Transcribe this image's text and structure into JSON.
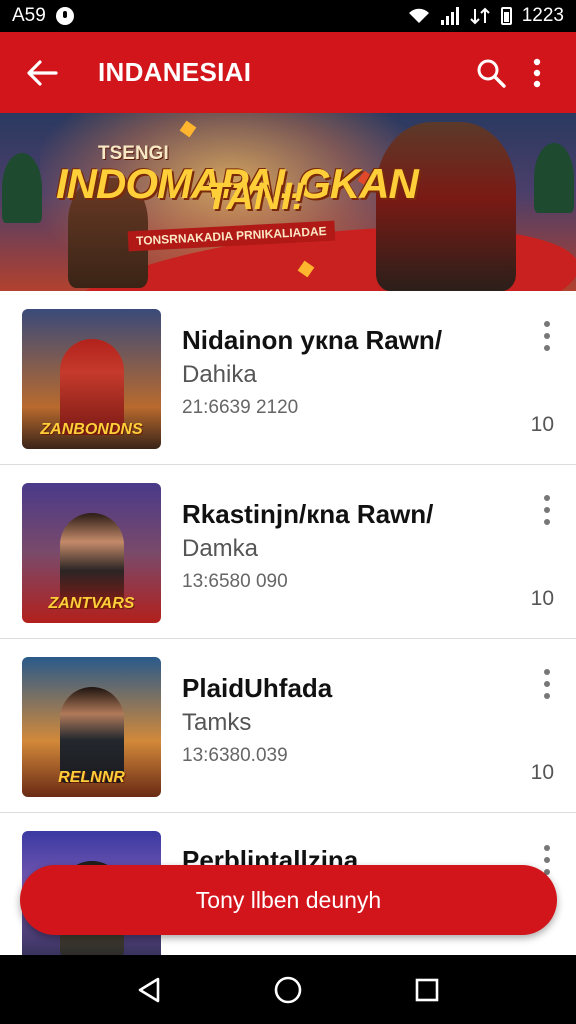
{
  "status_bar": {
    "left_text": "A59",
    "time": "1223",
    "icons": [
      "notification-dot-icon",
      "wifi-icon",
      "signal-icon",
      "data-icon",
      "battery-icon"
    ]
  },
  "app_bar": {
    "title": "INDANESIAI",
    "back_icon": "arrow-back-icon",
    "search_icon": "search-icon",
    "more_icon": "more-vertical-icon",
    "background": "#d2141b"
  },
  "banner": {
    "small_title": "TSENGI",
    "title_line1": "INDOMAPALGKAN",
    "title_line2": "TANI!",
    "subtitle": "TONSRNAKADIA PRNIKALIADAE"
  },
  "list": {
    "items": [
      {
        "title": "Nidainon yкna Rawn/",
        "subtitle": "Dahika",
        "meta": "21:6639 2120",
        "count": "10",
        "thumb_label": "ZANBONDNS"
      },
      {
        "title": "Rkastinjn/кna Rawn/",
        "subtitle": "Damka",
        "meta": "13:6580 090",
        "count": "10",
        "thumb_label": "ZANTVARS"
      },
      {
        "title": "PlaidUhfada",
        "subtitle": "Tamks",
        "meta": "13:6380.039",
        "count": "10",
        "thumb_label": "RELNNR"
      },
      {
        "title": "Perblintallzina",
        "subtitle": "",
        "meta": "",
        "count": "",
        "thumb_label": ""
      }
    ]
  },
  "fab": {
    "label": "Tony llben deunyh"
  },
  "nav_bar": {
    "icons": [
      "nav-back-icon",
      "nav-home-icon",
      "nav-recents-icon"
    ]
  },
  "colors": {
    "accent": "#d2141b",
    "status_bar": "#000000",
    "title_yellow": "#ffcf3a"
  }
}
